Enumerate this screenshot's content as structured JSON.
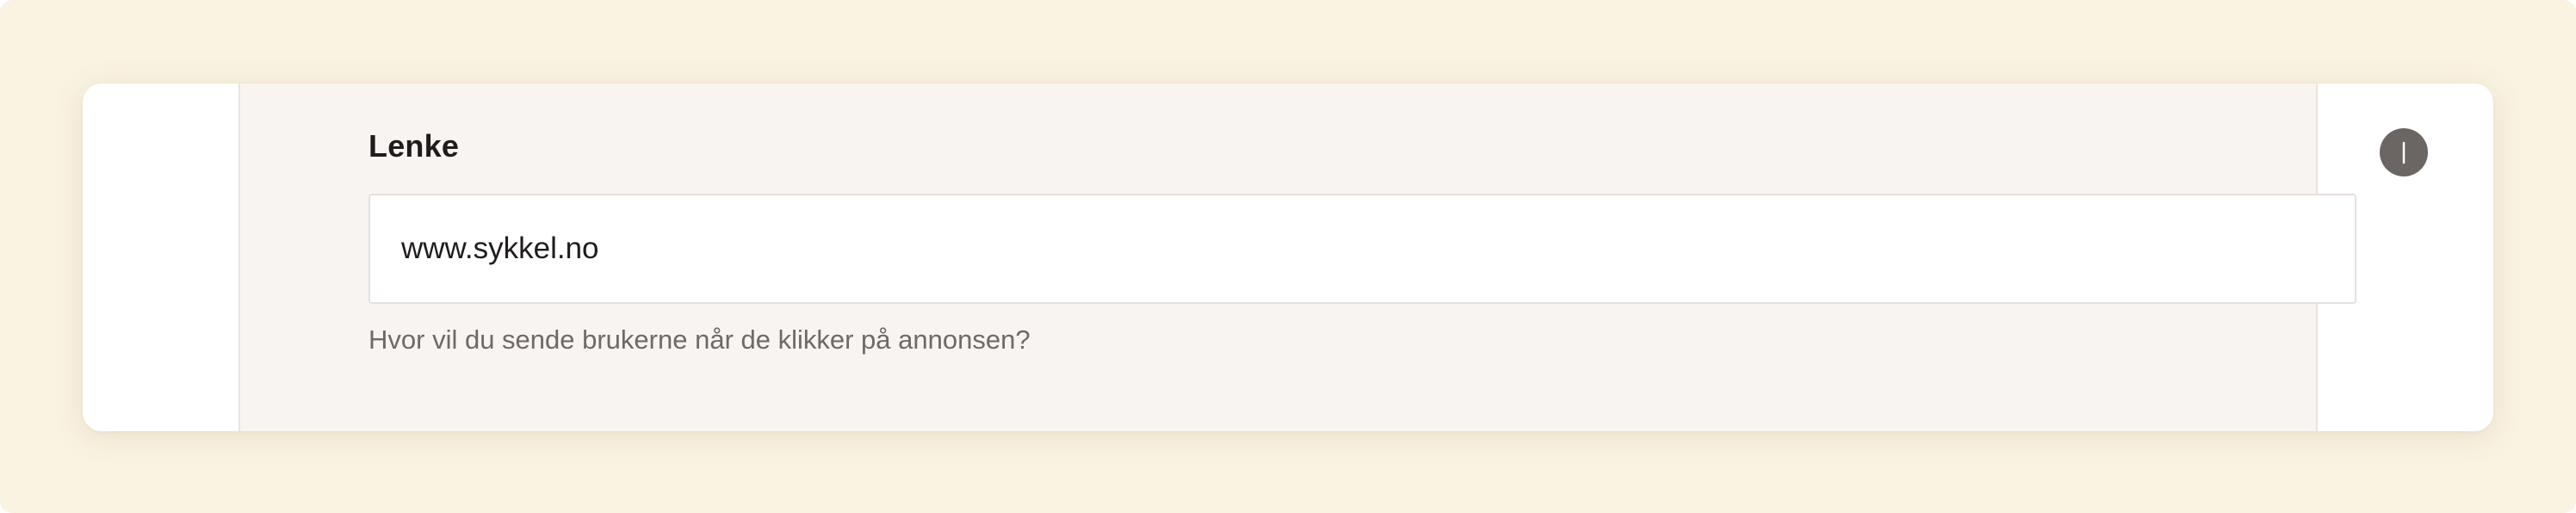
{
  "link_field": {
    "label": "Lenke",
    "value": "www.sykkel.no",
    "help_text": "Hvor vil du sende brukerne når de klikker på annonsen?",
    "info_icon": "info-icon"
  },
  "colors": {
    "background": "#faf3e2",
    "card": "#ffffff",
    "panel": "#f8f4f2",
    "info_button": "#6b6563",
    "text_primary": "#1f1c1b",
    "text_secondary": "#6f6866"
  }
}
